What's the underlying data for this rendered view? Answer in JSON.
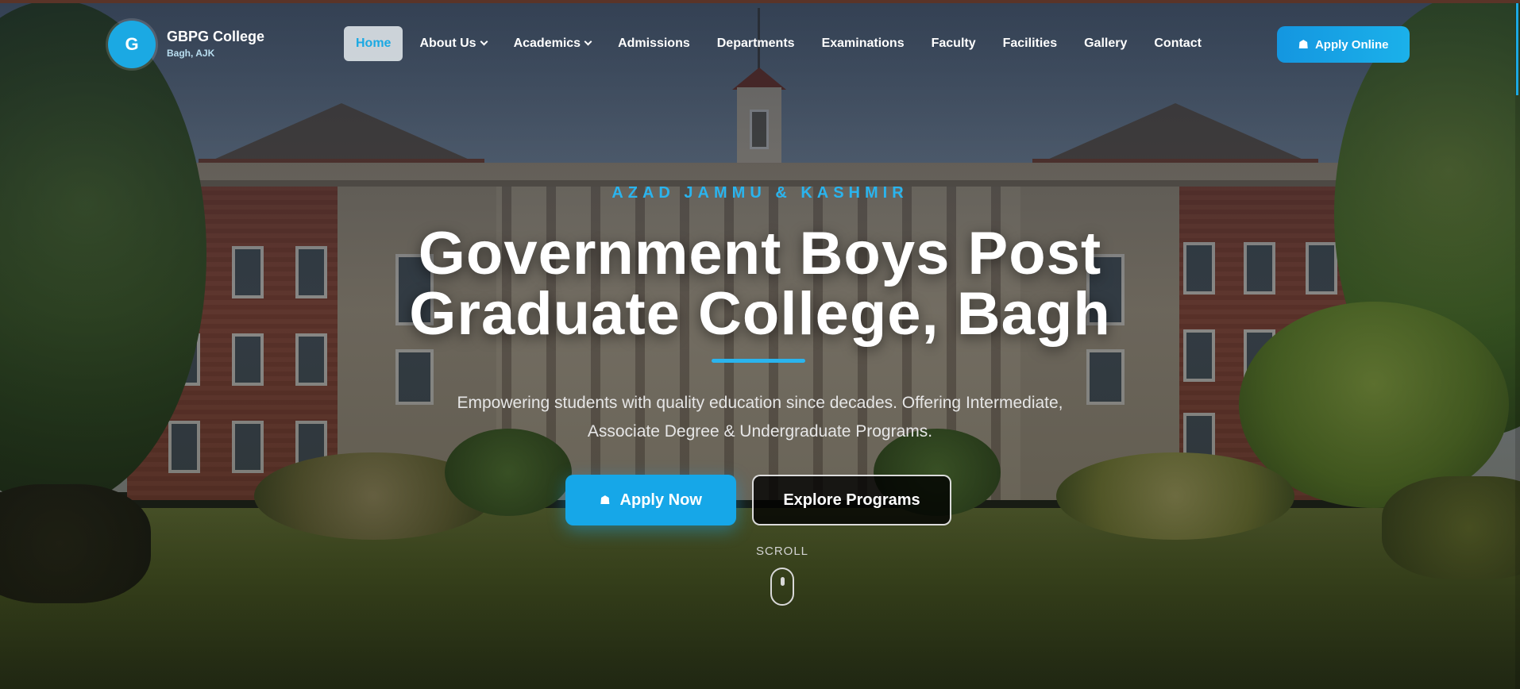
{
  "brand": {
    "logo_letter": "G",
    "name": "GBPG College",
    "location": "Bagh, AJK"
  },
  "nav": {
    "items": [
      {
        "label": "Home",
        "active": true
      },
      {
        "label": "About Us",
        "dropdown": true
      },
      {
        "label": "Academics",
        "dropdown": true
      },
      {
        "label": "Admissions"
      },
      {
        "label": "Departments"
      },
      {
        "label": "Examinations"
      },
      {
        "label": "Faculty"
      },
      {
        "label": "Facilities"
      },
      {
        "label": "Gallery"
      },
      {
        "label": "Contact"
      }
    ],
    "apply_online_label": "Apply Online",
    "apply_online_icon": "graduation-cap-icon"
  },
  "hero": {
    "eyebrow": "AZAD JAMMU & KASHMIR",
    "title_line1": "Government Boys Post",
    "title_line2": "Graduate College, Bagh",
    "subtitle_line1": "Empowering students with quality education since decades. Offering Intermediate,",
    "subtitle_line2": "Associate Degree & Undergraduate Programs.",
    "apply_now_label": "Apply Now",
    "explore_label": "Explore Programs",
    "scroll_label": "SCROLL"
  },
  "colors": {
    "accent": "#1ba9e3",
    "button_primary": "#16a7e8",
    "eyebrow": "#2ab4ee"
  },
  "cap_glyph": "☗"
}
